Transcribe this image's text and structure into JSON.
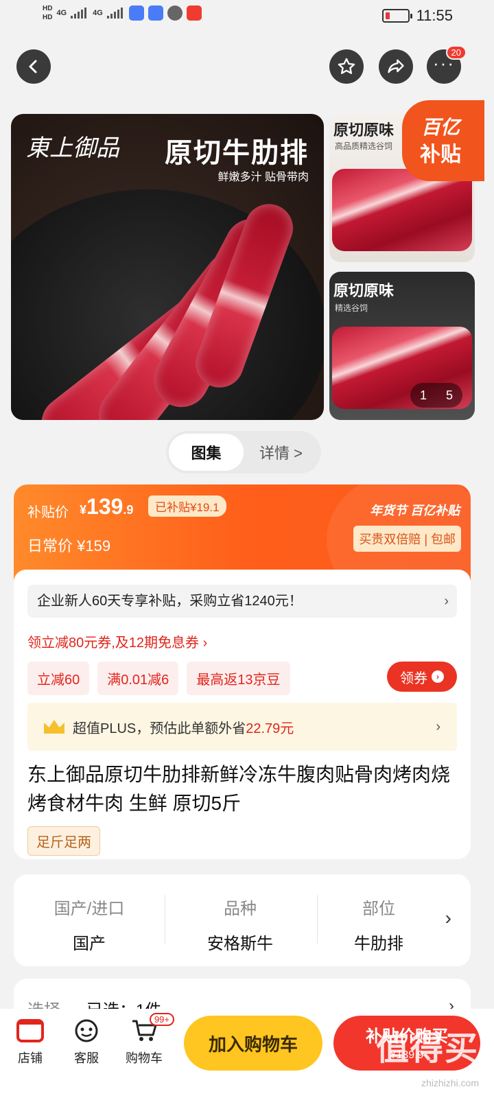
{
  "status_bar": {
    "network_left": "HD",
    "network_left_2": "HD",
    "signal_1": "4G",
    "signal_2": "4G",
    "time": "11:55"
  },
  "nav": {
    "back_icon": "back-arrow-icon",
    "favorite_icon": "star-icon",
    "share_icon": "share-icon",
    "more_icon": "more-dots-icon",
    "more_badge": "20"
  },
  "gallery": {
    "hero_title": "原切牛肋排",
    "hero_subtitle": "鲜嫩多汁 贴骨带肉",
    "thumb1_title": "原切原味",
    "thumb1_subtitle": "高品质精选谷饲",
    "thumb2_title": "原切原味",
    "thumb2_subtitle": "精选谷饲",
    "subsidy_line1": "百亿",
    "subsidy_line2": "补贴",
    "pager_current": "1",
    "pager_total": "5"
  },
  "tabs": [
    {
      "label": "图集",
      "active": true
    },
    {
      "label": "详情 >",
      "active": false
    }
  ],
  "price": {
    "subsidy_label": "补贴价",
    "currency": "¥",
    "subsidy_price_int": "139",
    "subsidy_price_dec": ".9",
    "subsidized_tag": "已补贴¥19.1",
    "daily_label": "日常价",
    "daily_price": "¥159",
    "brand_tag": "年货节 百亿补贴",
    "guarantee": "买贵双倍赔 | 包邮"
  },
  "promo": {
    "enterprise_line": "企业新人60天专享补贴，采购立省1240元！",
    "coupon_link": "领立减80元券,及12期免息券 ›",
    "chips": [
      "立减60",
      "满0.01减6",
      "最高返13京豆"
    ],
    "get_coupon": "领券",
    "plus_text": "超值PLUS，预估此单额外省",
    "plus_amount": "22.79元"
  },
  "product": {
    "title": "东上御品原切牛肋排新鲜冷冻牛腹肉贴骨肉烤肉烧烤食材牛肉 生鲜 原切5斤",
    "tag": "足斤足两"
  },
  "specs": [
    {
      "key": "国产/进口",
      "value": "国产"
    },
    {
      "key": "品种",
      "value": "安格斯牛"
    },
    {
      "key": "部位",
      "value": "牛肋排"
    }
  ],
  "selection": {
    "label": "选择",
    "value": "已选：1件"
  },
  "bottom_bar": {
    "store": "店铺",
    "service": "客服",
    "cart": "购物车",
    "cart_badge": "99+",
    "add_to_cart": "加入购物车",
    "buy_now": "补贴价购买",
    "buy_price": "¥139.9"
  },
  "watermark": {
    "text": "值得买",
    "url": "zhizhizhi.com"
  },
  "colors": {
    "accent_red": "#e1251b",
    "subsidy_orange": "#ff5f1a",
    "cart_yellow": "#ffc520"
  }
}
